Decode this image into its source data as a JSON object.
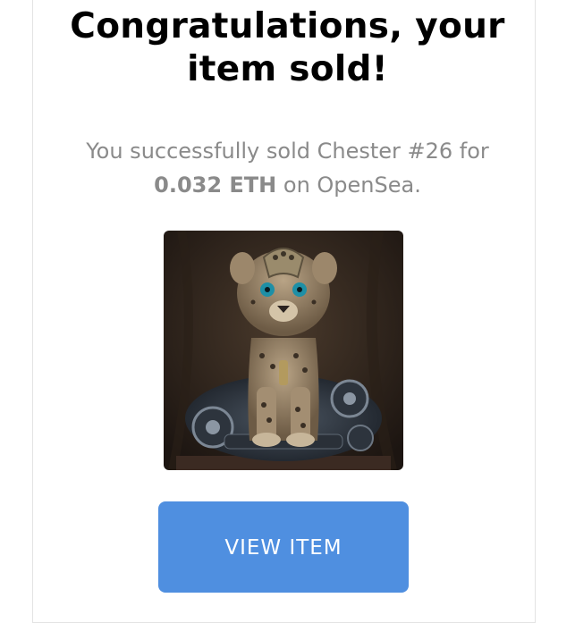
{
  "header": {
    "title_line1": "Congratulations, your",
    "title_line2": "item sold!"
  },
  "message": {
    "prefix": "You successfully sold Chester #26 for",
    "price": "0.032 ETH",
    "suffix": "on OpenSea."
  },
  "item": {
    "image_icon": "cheetah-cub-nft-image"
  },
  "actions": {
    "view_item_label": "VIEW ITEM"
  },
  "colors": {
    "button": "#4f8fe0",
    "title": "#000000",
    "message": "#8a8a8a"
  }
}
